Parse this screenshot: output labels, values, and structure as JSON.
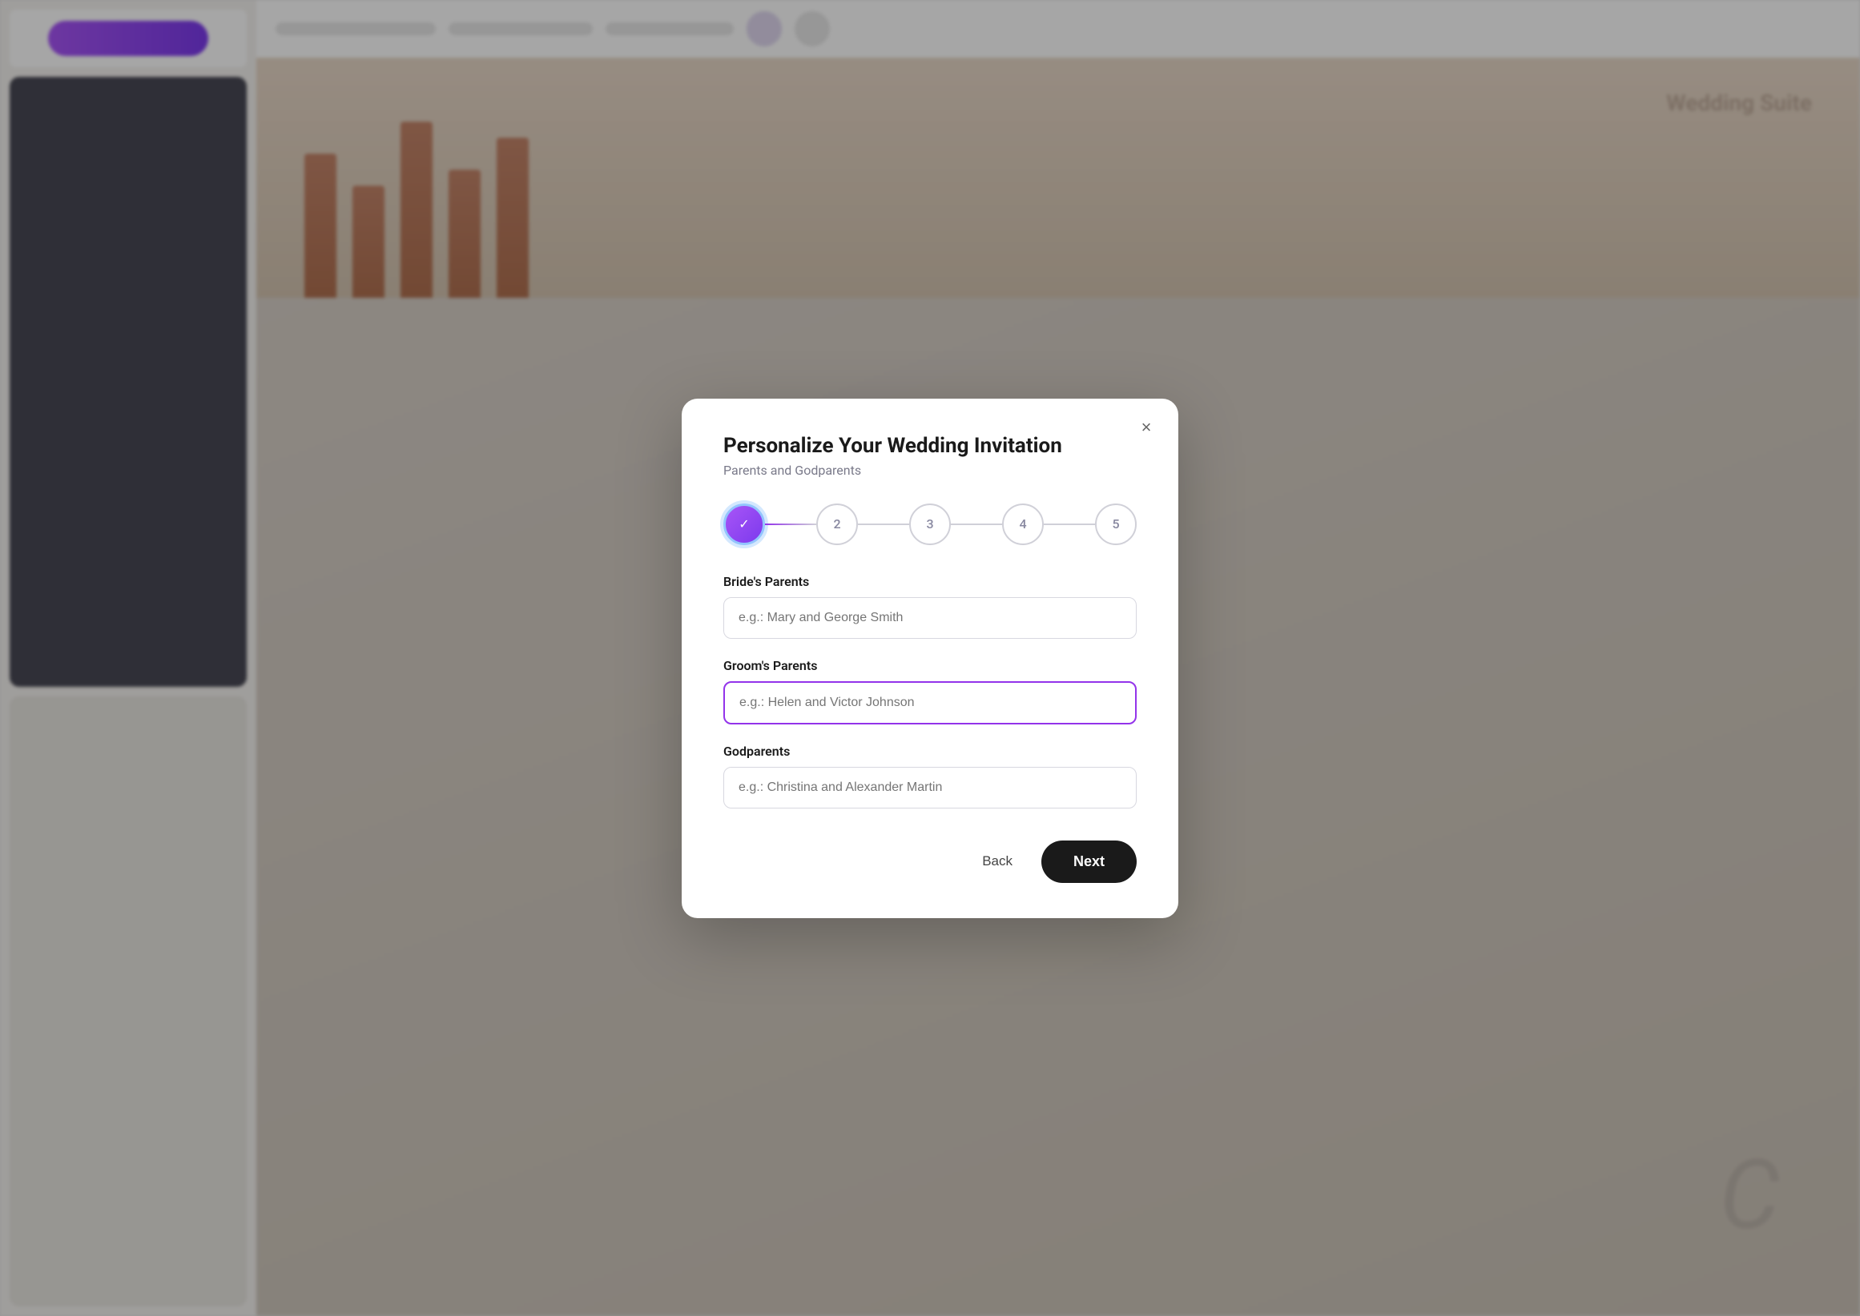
{
  "modal": {
    "title": "Personalize Your Wedding Invitation",
    "subtitle": "Parents and Godparents",
    "close_label": "×",
    "steps": [
      {
        "id": 1,
        "label": "✓",
        "state": "completed"
      },
      {
        "id": 2,
        "label": "2",
        "state": "inactive"
      },
      {
        "id": 3,
        "label": "3",
        "state": "inactive"
      },
      {
        "id": 4,
        "label": "4",
        "state": "inactive"
      },
      {
        "id": 5,
        "label": "5",
        "state": "inactive"
      }
    ],
    "fields": [
      {
        "id": "brides-parents",
        "label": "Bride's Parents",
        "placeholder": "e.g.: Mary and George Smith",
        "value": "",
        "active": false
      },
      {
        "id": "grooms-parents",
        "label": "Groom's Parents",
        "placeholder": "e.g.: Helen and Victor Johnson",
        "value": "",
        "active": true
      },
      {
        "id": "godparents",
        "label": "Godparents",
        "placeholder": "e.g.: Christina and Alexander Martin",
        "value": "",
        "active": false
      }
    ],
    "buttons": {
      "back": "Back",
      "next": "Next"
    }
  }
}
